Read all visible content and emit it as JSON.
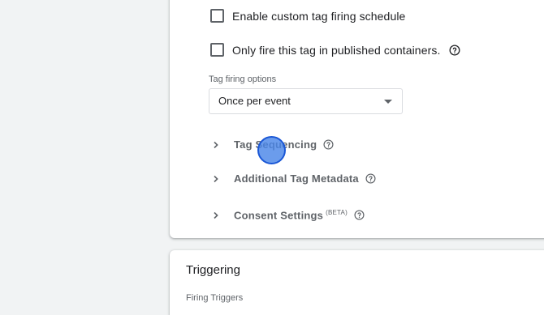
{
  "tag_config": {
    "checkboxes": [
      {
        "label": "Enable custom tag firing schedule",
        "checked": false
      },
      {
        "label": "Only fire this tag in published containers.",
        "checked": false
      }
    ],
    "firing_options": {
      "label": "Tag firing options",
      "selected": "Once per event"
    },
    "advanced_sections": [
      {
        "label": "Tag Sequencing",
        "icon": "chevron-right-icon"
      },
      {
        "label": "Additional Tag Metadata",
        "icon": "chevron-right-icon"
      },
      {
        "label": "Consent Settings",
        "badge": "(BETA)",
        "icon": "chevron-right-icon"
      }
    ]
  },
  "triggering": {
    "title": "Triggering",
    "subtitle": "Firing Triggers"
  },
  "colors": {
    "background": "#f1f3f4",
    "card": "#ffffff",
    "click_indicator": "#4a86e8"
  }
}
